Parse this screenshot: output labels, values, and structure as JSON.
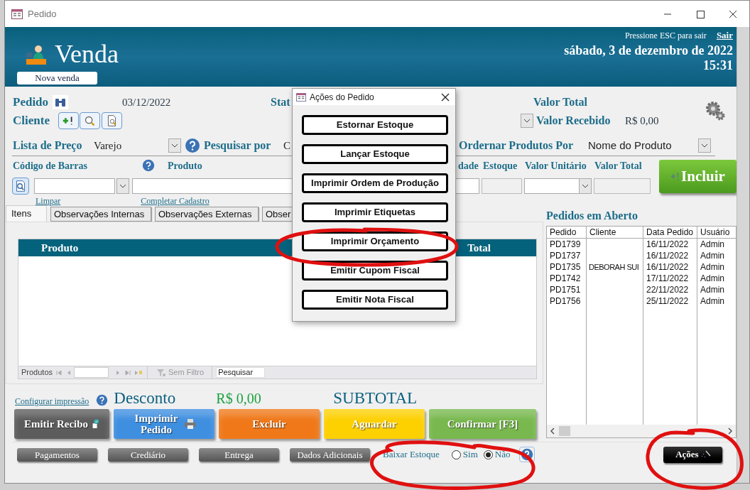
{
  "window": {
    "title": "Pedido"
  },
  "header": {
    "title": "Venda",
    "new_button": "Nova venda",
    "esc_hint": "Pressione ESC para sair",
    "exit_link": "Sair",
    "date": "sábado, 3 de dezembro de 2022",
    "time": "15:31"
  },
  "order": {
    "label": "Pedido",
    "date": "03/12/2022",
    "status_label": "Stat",
    "total_label": "Valor Total"
  },
  "client": {
    "label": "Cliente",
    "received_label": "Valor Recebido",
    "received_value": "R$ 0,00"
  },
  "price_list": {
    "label": "Lista de Preço",
    "value": "Varejo",
    "search_label": "Pesquisar por",
    "search_value": "C",
    "sort_label": "Ordernar Produtos Por",
    "sort_value": "Nome do Produto"
  },
  "entry": {
    "barcode_label": "Código de Barras",
    "product_label": "Produto",
    "quantity_label": "dade",
    "stock_label": "Estoque",
    "unit_price_label": "Valor Unitário",
    "total_label": "Valor Total",
    "add_button": "Incluir",
    "clear_link": "Limpar",
    "complete_link": "Completar Cadastro"
  },
  "tabs": [
    {
      "label": "Itens",
      "selected": true
    },
    {
      "label": "Observações Internas",
      "selected": false
    },
    {
      "label": "Observações Externas",
      "selected": false
    },
    {
      "label": "Obser",
      "selected": false
    }
  ],
  "items": {
    "product_column": "Produto",
    "total_column": "Total",
    "nav_label": "Produtos",
    "filter": "Sem Filtro",
    "search_placeholder": "Pesquisar"
  },
  "open_orders": {
    "title": "Pedidos em Aberto",
    "columns": [
      "Pedido",
      "Cliente",
      "Data Pedido",
      "Usuário"
    ],
    "rows": [
      {
        "order": "PD1739",
        "date": "16/11/2022",
        "user": "Admin"
      },
      {
        "order": "PD1737",
        "date": "16/11/2022",
        "user": "Admin"
      },
      {
        "order": "PD1735",
        "client": "DEBORAH SUI",
        "date": "16/11/2022",
        "user": "Admin"
      },
      {
        "order": "PD1742",
        "date": "17/11/2022",
        "user": "Admin"
      },
      {
        "order": "PD1751",
        "date": "22/11/2022",
        "user": "Admin"
      },
      {
        "order": "PD1756",
        "date": "25/11/2022",
        "user": "Admin"
      }
    ]
  },
  "totals": {
    "print_config_link": "Configurar impressão",
    "discount_label": "Desconto",
    "discount_value": "R$ 0,00",
    "subtotal_label": "SUBTOTAL"
  },
  "actions": [
    {
      "label": "Emitir Recibo",
      "kind": "receipt",
      "color": "#5c5c5c"
    },
    {
      "label": "Imprimir Pedido",
      "kind": "print",
      "color": "#3f8fe0"
    },
    {
      "label": "Excluir",
      "kind": "plain",
      "color": "#f07818"
    },
    {
      "label": "Aguardar",
      "kind": "plain",
      "color": "#fdd000"
    },
    {
      "label": "Confirmar [F3]",
      "kind": "plain",
      "color": "#78b84e"
    }
  ],
  "secondary_buttons": [
    "Pagamentos",
    "Crediário",
    "Entrega",
    "Dados Adicionais"
  ],
  "stock_option": {
    "label": "Baixar Estoque",
    "options": [
      {
        "label": "Sim",
        "selected": false
      },
      {
        "label": "Não",
        "selected": true
      }
    ]
  },
  "actions_button": "Ações",
  "dialog": {
    "title": "Ações do Pedido",
    "buttons": [
      "Estornar Estoque",
      "Lançar Estoque",
      "Imprimir Ordem de Produção",
      "Imprimir Etiquetas",
      "Imprimir Orçamento",
      "Emitir Cupom Fiscal",
      "Emitir Nota Fiscal"
    ]
  },
  "annotations": [
    {
      "kind": "ellipse"
    },
    {
      "kind": "ellipse"
    },
    {
      "kind": "ellipse"
    }
  ]
}
